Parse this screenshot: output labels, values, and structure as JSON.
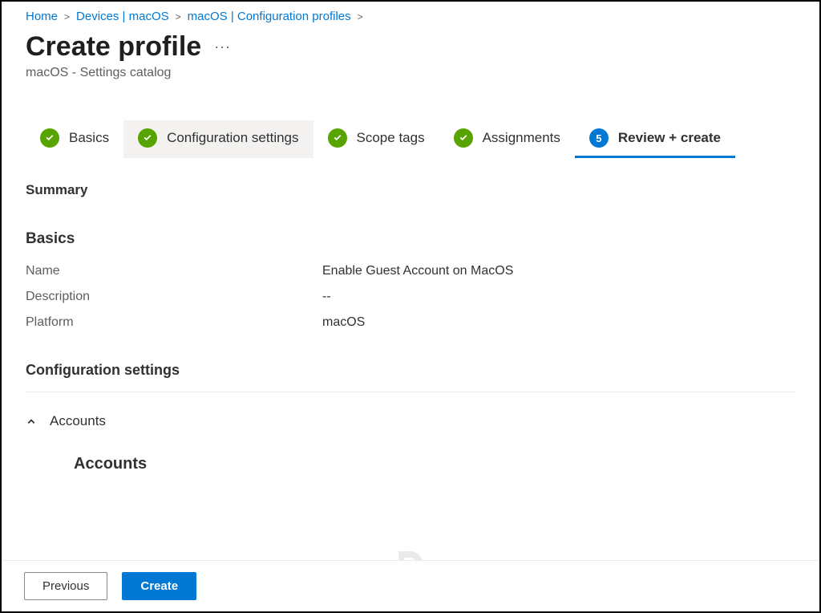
{
  "breadcrumb": {
    "items": [
      "Home",
      "Devices | macOS",
      "macOS | Configuration profiles"
    ]
  },
  "header": {
    "title": "Create profile",
    "subtitle": "macOS - Settings catalog"
  },
  "stepper": {
    "steps": [
      {
        "label": "Basics",
        "state": "done"
      },
      {
        "label": "Configuration settings",
        "state": "done"
      },
      {
        "label": "Scope tags",
        "state": "done"
      },
      {
        "label": "Assignments",
        "state": "done"
      },
      {
        "label": "Review + create",
        "state": "active",
        "number": "5"
      }
    ]
  },
  "summary": {
    "heading": "Summary",
    "basics_heading": "Basics",
    "fields": {
      "name_label": "Name",
      "name_value": "Enable Guest Account on MacOS",
      "description_label": "Description",
      "description_value": "--",
      "platform_label": "Platform",
      "platform_value": "macOS"
    },
    "config_heading": "Configuration settings",
    "accordion": {
      "title": "Accounts",
      "subtitle": "Accounts"
    }
  },
  "footer": {
    "previous": "Previous",
    "create": "Create"
  }
}
